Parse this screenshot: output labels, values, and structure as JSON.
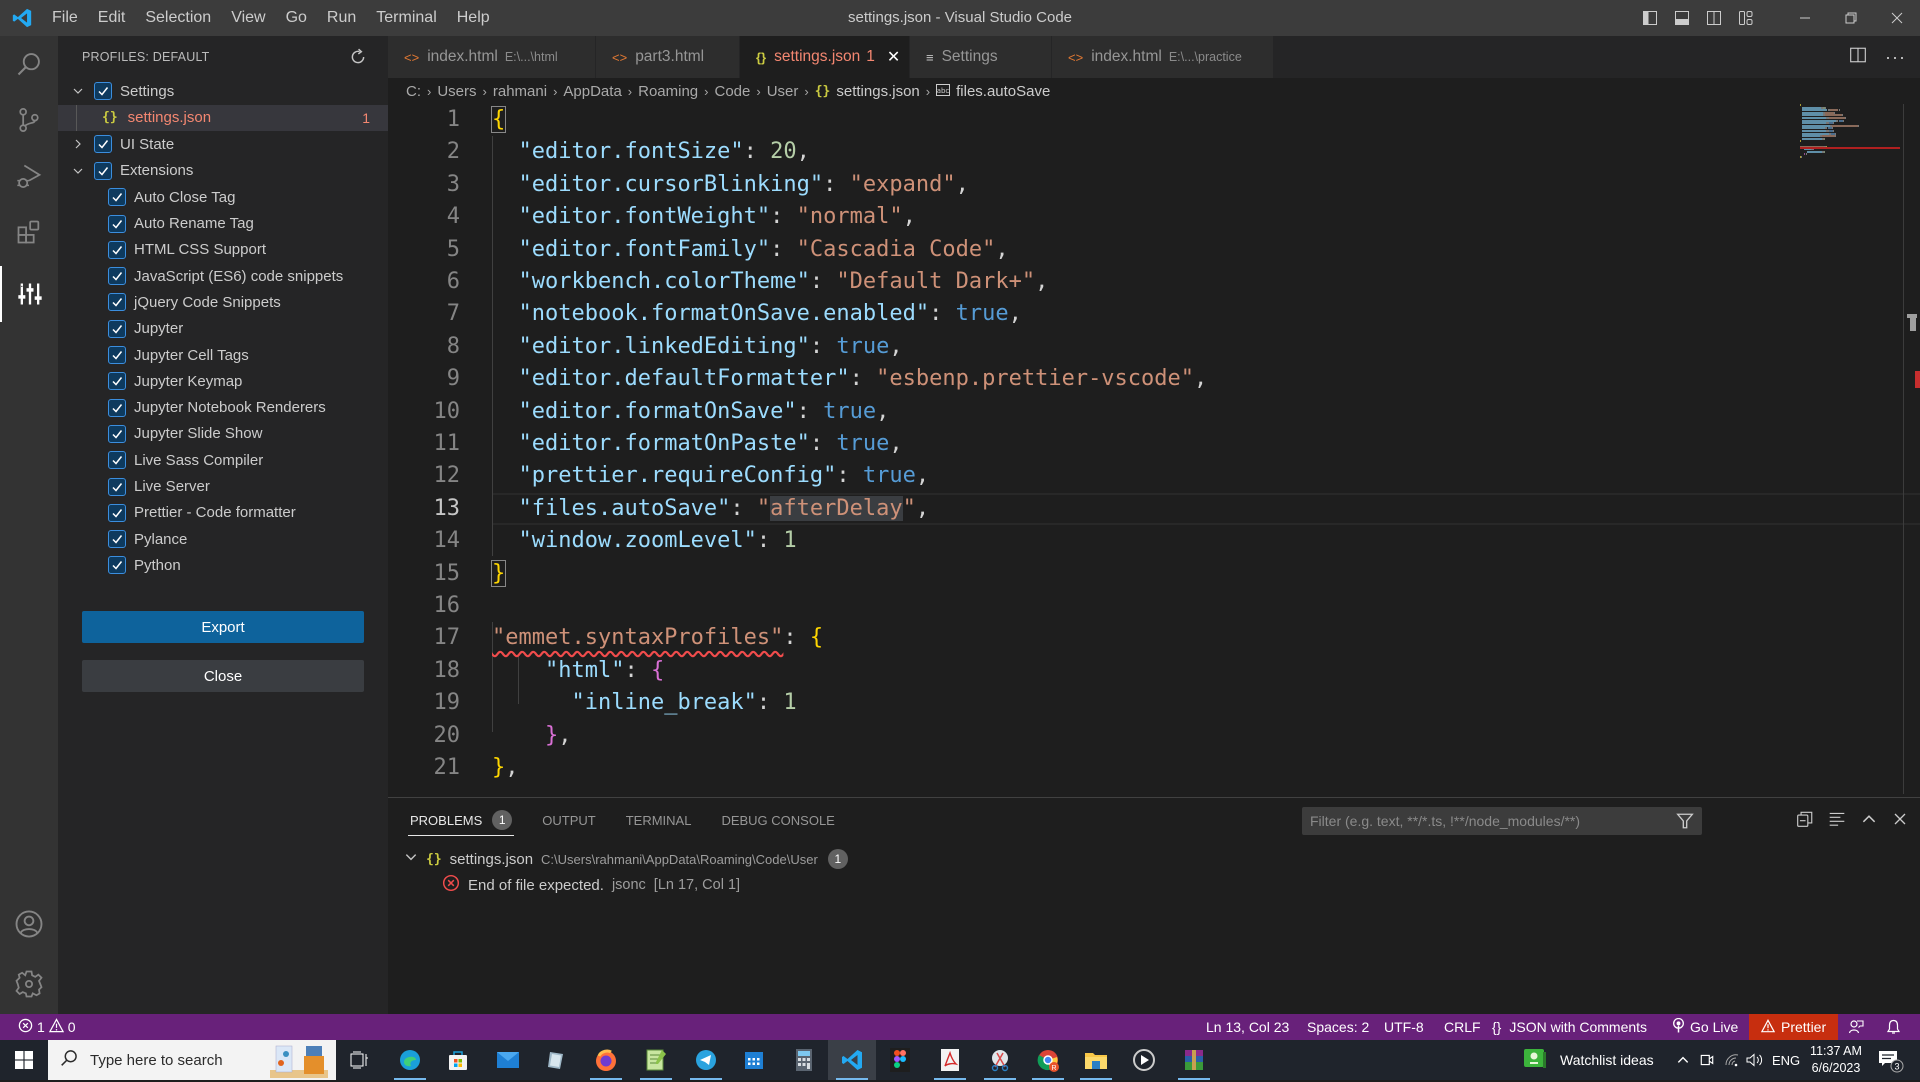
{
  "titlebar": {
    "menu": [
      "File",
      "Edit",
      "Selection",
      "View",
      "Go",
      "Run",
      "Terminal",
      "Help"
    ],
    "window_title": "settings.json - Visual Studio Code",
    "layout_icons": [
      "toggle-primary-sidebar-icon",
      "toggle-panel-icon",
      "toggle-secondary-sidebar-icon",
      "customize-layout-icon"
    ],
    "window_controls": [
      "minimize",
      "restore",
      "close"
    ]
  },
  "activitybar": {
    "top": [
      "search",
      "source-control",
      "run-and-debug",
      "extensions",
      "profiles"
    ],
    "bottom": [
      "accounts",
      "manage"
    ]
  },
  "sidebar": {
    "header": "PROFILES: DEFAULT",
    "tree": [
      {
        "label": "Settings",
        "expanded": true,
        "checked": true
      },
      {
        "label": "settings.json",
        "count": "1",
        "selected": true
      },
      {
        "label": "UI State",
        "expanded": false,
        "checked": true
      },
      {
        "label": "Extensions",
        "expanded": true,
        "checked": true
      }
    ],
    "extensions": [
      "Auto Close Tag",
      "Auto Rename Tag",
      "HTML CSS Support",
      "JavaScript (ES6) code snippets",
      "jQuery Code Snippets",
      "Jupyter",
      "Jupyter Cell Tags",
      "Jupyter Keymap",
      "Jupyter Notebook Renderers",
      "Jupyter Slide Show",
      "Live Sass Compiler",
      "Live Server",
      "Prettier - Code formatter",
      "Pylance",
      "Python"
    ],
    "export_label": "Export",
    "close_label": "Close"
  },
  "tabs": [
    {
      "label": "index.html",
      "desc": "E:\\...\\html",
      "icon": "<>",
      "active": false
    },
    {
      "label": "part3.html",
      "desc": "",
      "icon": "<>",
      "active": false
    },
    {
      "label": "settings.json",
      "desc": "",
      "badge": "1",
      "icon": "{}",
      "active": true
    },
    {
      "label": "Settings",
      "desc": "",
      "icon": "≡",
      "active": false
    },
    {
      "label": "index.html",
      "desc": "E:\\...\\practice",
      "icon": "<>",
      "active": false
    }
  ],
  "breadcrumb": [
    "C:",
    "Users",
    "rahmani",
    "AppData",
    "Roaming",
    "Code",
    "User",
    "settings.json",
    "files.autoSave"
  ],
  "editor": {
    "current_line": 13,
    "lines": [
      {
        "n": "1",
        "tokens": [
          [
            "br1",
            "{"
          ]
        ]
      },
      {
        "n": "2",
        "tokens": [
          [
            "p",
            "  "
          ],
          [
            "k",
            "\"editor.fontSize\""
          ],
          [
            "p",
            ": "
          ],
          [
            "n",
            "20"
          ],
          [
            "p",
            ","
          ]
        ]
      },
      {
        "n": "3",
        "tokens": [
          [
            "p",
            "  "
          ],
          [
            "k",
            "\"editor.cursorBlinking\""
          ],
          [
            "p",
            ": "
          ],
          [
            "s",
            "\"expand\""
          ],
          [
            "p",
            ","
          ]
        ]
      },
      {
        "n": "4",
        "tokens": [
          [
            "p",
            "  "
          ],
          [
            "k",
            "\"editor.fontWeight\""
          ],
          [
            "p",
            ": "
          ],
          [
            "s",
            "\"normal\""
          ],
          [
            "p",
            ","
          ]
        ]
      },
      {
        "n": "5",
        "tokens": [
          [
            "p",
            "  "
          ],
          [
            "k",
            "\"editor.fontFamily\""
          ],
          [
            "p",
            ": "
          ],
          [
            "s",
            "\"Cascadia Code\""
          ],
          [
            "p",
            ","
          ]
        ]
      },
      {
        "n": "6",
        "tokens": [
          [
            "p",
            "  "
          ],
          [
            "k",
            "\"workbench.colorTheme\""
          ],
          [
            "p",
            ": "
          ],
          [
            "s",
            "\"Default Dark+\""
          ],
          [
            "p",
            ","
          ]
        ]
      },
      {
        "n": "7",
        "tokens": [
          [
            "p",
            "  "
          ],
          [
            "k",
            "\"notebook.formatOnSave.enabled\""
          ],
          [
            "p",
            ": "
          ],
          [
            "b",
            "true"
          ],
          [
            "p",
            ","
          ]
        ]
      },
      {
        "n": "8",
        "tokens": [
          [
            "p",
            "  "
          ],
          [
            "k",
            "\"editor.linkedEditing\""
          ],
          [
            "p",
            ": "
          ],
          [
            "b",
            "true"
          ],
          [
            "p",
            ","
          ]
        ]
      },
      {
        "n": "9",
        "tokens": [
          [
            "p",
            "  "
          ],
          [
            "k",
            "\"editor.defaultFormatter\""
          ],
          [
            "p",
            ": "
          ],
          [
            "s",
            "\"esbenp.prettier-vscode\""
          ],
          [
            "p",
            ","
          ]
        ]
      },
      {
        "n": "10",
        "tokens": [
          [
            "p",
            "  "
          ],
          [
            "k",
            "\"editor.formatOnSave\""
          ],
          [
            "p",
            ": "
          ],
          [
            "b",
            "true"
          ],
          [
            "p",
            ","
          ]
        ]
      },
      {
        "n": "11",
        "tokens": [
          [
            "p",
            "  "
          ],
          [
            "k",
            "\"editor.formatOnPaste\""
          ],
          [
            "p",
            ": "
          ],
          [
            "b",
            "true"
          ],
          [
            "p",
            ","
          ]
        ]
      },
      {
        "n": "12",
        "tokens": [
          [
            "p",
            "  "
          ],
          [
            "k",
            "\"prettier.requireConfig\""
          ],
          [
            "p",
            ": "
          ],
          [
            "b",
            "true"
          ],
          [
            "p",
            ","
          ]
        ]
      },
      {
        "n": "13",
        "tokens": [
          [
            "p",
            "  "
          ],
          [
            "k",
            "\"files.autoSave\""
          ],
          [
            "p",
            ": "
          ],
          [
            "s",
            "\""
          ],
          [
            "s sel",
            "afterDelay"
          ],
          [
            "s",
            "\""
          ],
          [
            "p",
            ","
          ]
        ]
      },
      {
        "n": "14",
        "tokens": [
          [
            "p",
            "  "
          ],
          [
            "k",
            "\"window.zoomLevel\""
          ],
          [
            "p",
            ": "
          ],
          [
            "n",
            "1"
          ]
        ]
      },
      {
        "n": "15",
        "tokens": [
          [
            "br1",
            "}"
          ]
        ]
      },
      {
        "n": "16",
        "tokens": []
      },
      {
        "n": "17",
        "tokens": [
          [
            "s squiggle",
            "\"emmet.syntaxProfiles\""
          ],
          [
            "p",
            ": "
          ],
          [
            "br1",
            "{"
          ]
        ]
      },
      {
        "n": "18",
        "tokens": [
          [
            "p",
            "    "
          ],
          [
            "k",
            "\"html\""
          ],
          [
            "p",
            ": "
          ],
          [
            "br2",
            "{"
          ]
        ]
      },
      {
        "n": "19",
        "tokens": [
          [
            "p",
            "      "
          ],
          [
            "k",
            "\"inline_break\""
          ],
          [
            "p",
            ": "
          ],
          [
            "n",
            "1"
          ]
        ]
      },
      {
        "n": "20",
        "tokens": [
          [
            "p",
            "    "
          ],
          [
            "br2",
            "}"
          ],
          [
            "p",
            ","
          ]
        ]
      },
      {
        "n": "21",
        "tokens": [
          [
            "br1",
            "}"
          ],
          [
            "p",
            ","
          ]
        ]
      }
    ]
  },
  "panel": {
    "tabs": [
      {
        "label": "PROBLEMS",
        "badge": "1",
        "active": true
      },
      {
        "label": "OUTPUT"
      },
      {
        "label": "TERMINAL"
      },
      {
        "label": "DEBUG CONSOLE"
      }
    ],
    "filter_placeholder": "Filter (e.g. text, **/*.ts, !**/node_modules/**)",
    "problems": {
      "file": "settings.json",
      "path": "C:\\Users\\rahmani\\AppData\\Roaming\\Code\\User",
      "count": "1",
      "items": [
        {
          "message": "End of file expected.",
          "source": "jsonc",
          "location": "[Ln 17, Col 1]"
        }
      ]
    }
  },
  "statusbar": {
    "errors": "1",
    "warnings": "0",
    "position": "Ln 13, Col 23",
    "spaces": "Spaces: 2",
    "encoding": "UTF-8",
    "eol": "CRLF",
    "language": "JSON with Comments",
    "go_live": "Go Live",
    "prettier": "Prettier",
    "colors": {
      "background": "#68217a",
      "prettier": "#c72e0f"
    }
  },
  "taskbar": {
    "search_placeholder": "Type here to search",
    "apps": [
      "task-view",
      "edge",
      "store",
      "mail",
      "notes",
      "firefox",
      "notepad-plus",
      "telegram",
      "calendar",
      "calculator",
      "vscode",
      "figma",
      "acrobat",
      "snip",
      "chrome",
      "file-explorer",
      "media-player",
      "winrar"
    ],
    "widget_label": "Watchlist ideas",
    "language": "ENG",
    "time": "11:37 AM",
    "date": "6/6/2023",
    "notification_count": "3"
  }
}
